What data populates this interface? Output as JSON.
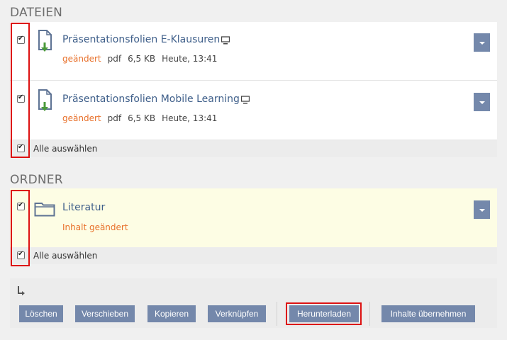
{
  "files_section": {
    "title": "DATEIEN",
    "items": [
      {
        "name": "Präsentationsfolien E-Klausuren",
        "status": "geändert",
        "type": "pdf",
        "size": "6,5 KB",
        "date": "Heute, 13:41"
      },
      {
        "name": "Präsentationsfolien Mobile Learning",
        "status": "geändert",
        "type": "pdf",
        "size": "6,5 KB",
        "date": "Heute, 13:41"
      }
    ],
    "select_all": "Alle auswählen"
  },
  "folders_section": {
    "title": "ORDNER",
    "items": [
      {
        "name": "Literatur",
        "status": "Inhalt geändert"
      }
    ],
    "select_all": "Alle auswählen"
  },
  "actions": {
    "delete": "Löschen",
    "move": "Verschieben",
    "copy": "Kopieren",
    "link": "Verknüpfen",
    "download": "Herunterladen",
    "take_content": "Inhalte übernehmen"
  },
  "colors": {
    "button_bg": "#7488ab",
    "changed_text": "#e8702a",
    "title_link": "#3f5f8a",
    "highlight_row": "#fdfde4",
    "annotation_red": "#dd1111"
  }
}
